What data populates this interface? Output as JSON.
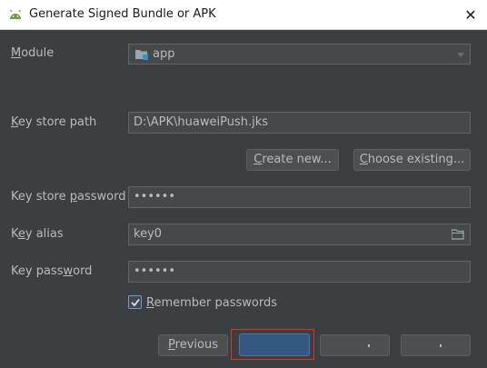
{
  "window": {
    "title": "Generate Signed Bundle or APK",
    "close_glyph": "✕"
  },
  "module": {
    "label_mnemonic": "M",
    "label_rest": "odule",
    "value": "app",
    "icon": "module-folder-icon"
  },
  "key_store_path": {
    "label_mnemonic": "K",
    "label_rest": "ey store path",
    "value": "D:\\APK\\huaweiPush.jks"
  },
  "create_new_button": {
    "mnemonic": "C",
    "rest": "reate new..."
  },
  "choose_existing_button": {
    "mnemonic": "C",
    "rest": "hoose existing..."
  },
  "key_store_password": {
    "label_before": "Key store ",
    "label_mnemonic": "p",
    "label_after": "assword",
    "value": "••••••"
  },
  "key_alias": {
    "label_before": "K",
    "label_mnemonic": "e",
    "label_after": "y alias",
    "value": "key0",
    "icon": "browse-folder-icon"
  },
  "key_password": {
    "label_before": "Key pass",
    "label_mnemonic": "w",
    "label_after": "ord",
    "value": "••••••"
  },
  "remember_passwords": {
    "mnemonic": "R",
    "rest": "emember passwords",
    "checked": true
  },
  "footer": {
    "previous_mnemonic": "P",
    "previous_rest": "revious"
  },
  "colors": {
    "background": "#3c3f41",
    "field": "#45494a",
    "accent": "#365880",
    "highlight": "#e2311d"
  }
}
